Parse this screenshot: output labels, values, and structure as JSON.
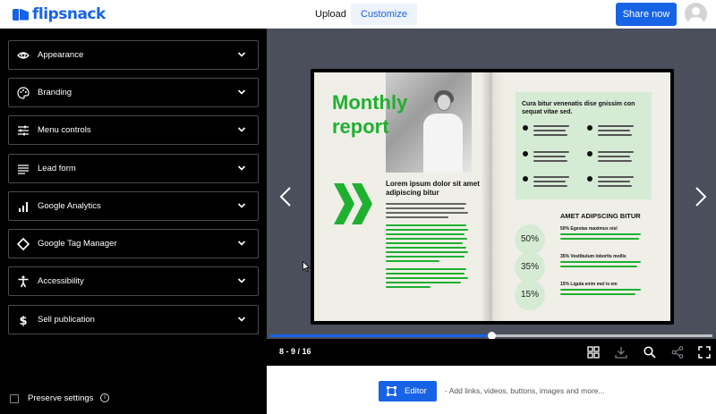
{
  "header": {
    "logo_text": "flipsnack",
    "nav": {
      "upload": "Upload",
      "customize": "Customize"
    },
    "share_label": "Share now"
  },
  "sidebar": {
    "items": [
      {
        "label": "Appearance",
        "icon": "eye-icon"
      },
      {
        "label": "Branding",
        "icon": "palette-icon"
      },
      {
        "label": "Menu controls",
        "icon": "sliders-icon"
      },
      {
        "label": "Lead form",
        "icon": "list-form-icon"
      },
      {
        "label": "Google Analytics",
        "icon": "bar-chart-icon"
      },
      {
        "label": "Google Tag Manager",
        "icon": "diamond-tag-icon"
      },
      {
        "label": "Accessibility",
        "icon": "accessibility-icon"
      },
      {
        "label": "Sell publication",
        "icon": "dollar-icon"
      }
    ],
    "preserve": {
      "label": "Preserve settings",
      "checked": false
    }
  },
  "viewer": {
    "book": {
      "left": {
        "title_line1": "Monthly",
        "title_line2": "report",
        "heading": "Lorem ipsum dolor sit amet adipiscing bitur"
      },
      "right": {
        "box_heading": "Cura bitur venenatis dise gnissim con sequat vitae sed.",
        "section_heading": "AMET ADIPSCING BITUR",
        "stats": [
          {
            "value": "50%",
            "label": "50% Egestas maximus nisl"
          },
          {
            "value": "35%",
            "label": "35% Vestibulum lobortis mollis"
          },
          {
            "value": "15%",
            "label": "15% Ligula enim mol is em"
          }
        ]
      },
      "accent_color": "#1fb02f",
      "box_color": "#d6ebd4"
    },
    "page_indicator": "8 - 9 / 16",
    "progress": 0.5
  },
  "bottom": {
    "editor_label": "Editor",
    "hint": "- Add links, videos, buttons, images and more..."
  },
  "colors": {
    "brand": "#1763e6",
    "sidebar_bg": "#000000",
    "viewer_bg": "#4b4f5b"
  }
}
